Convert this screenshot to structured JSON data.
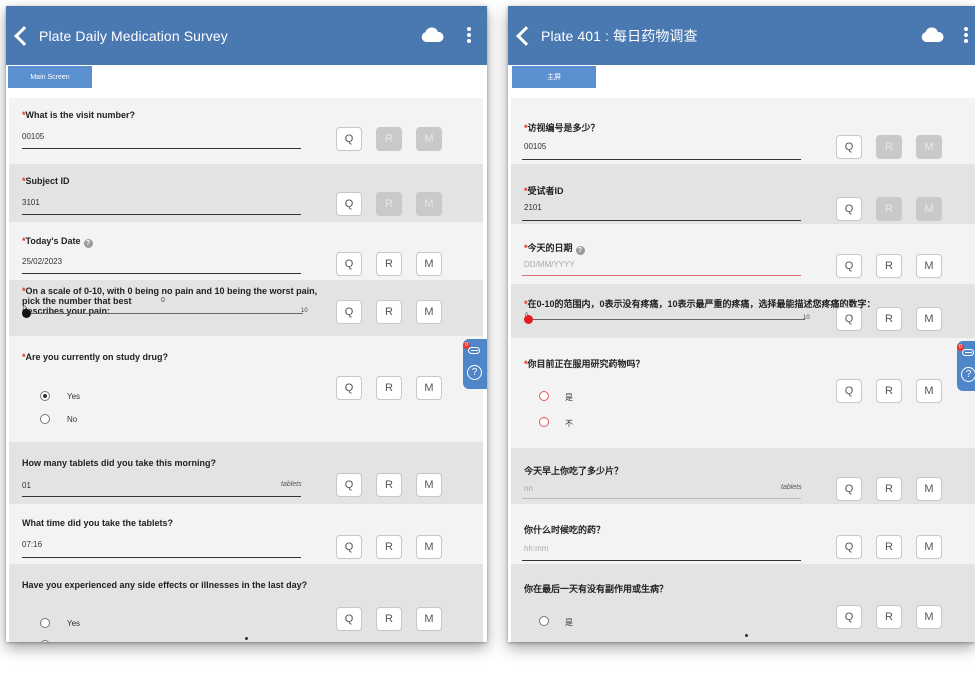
{
  "left": {
    "title": "Plate Daily Medication Survey",
    "tab": "Main Screen",
    "buttons": {
      "q": "Q",
      "r": "R",
      "m": "M"
    },
    "q1": {
      "label": "What is the visit number?",
      "value": "00105"
    },
    "q2": {
      "label": "Subject ID",
      "value": "3101"
    },
    "q3": {
      "label": "Today's Date",
      "value": "25/02/2023"
    },
    "q4": {
      "label_line1": "On a scale of 0-10, with 0 being no pain and 10 being the worst pain, pick the number that best",
      "label_line2": "describes your pain:",
      "current": "0",
      "min": "0",
      "max": "10",
      "level": 0
    },
    "q5": {
      "label": "Are you currently on study drug?",
      "options": [
        "Yes",
        "No"
      ],
      "selected": "Yes"
    },
    "q6": {
      "label": "How many tablets did you take this morning?",
      "value": "01",
      "unit": "tablets"
    },
    "q7": {
      "label": "What time did you take the tablets?",
      "value": "07:16"
    },
    "q8": {
      "label": "Have you experienced any side effects or illnesses in the last day?",
      "options": [
        "Yes"
      ]
    },
    "badge": "0",
    "help": "?"
  },
  "right": {
    "title": "Plate 401 : 每日药物调查",
    "tab": "主屏",
    "buttons": {
      "q": "Q",
      "r": "R",
      "m": "M"
    },
    "q1": {
      "label": "访视编号是多少？",
      "value": "00105"
    },
    "q2": {
      "label": "受试者ID",
      "value": "2101"
    },
    "q3": {
      "label": "今天的日期",
      "placeholder": "DD/MM/YYYY"
    },
    "q4": {
      "label": "在0-10的范围内，0表示没有疼痛，10表示最严重的疼痛，选择最能描述您疼痛的数字：",
      "min": "0",
      "max": "10",
      "level": 0
    },
    "q5": {
      "label": "你目前正在服用研究药物吗？",
      "options": [
        "是",
        "不"
      ]
    },
    "q6": {
      "label": "今天早上你吃了多少片？",
      "placeholder": "nn",
      "unit": "tablets"
    },
    "q7": {
      "label": "你什么时候吃的药？",
      "placeholder": "hh:mm"
    },
    "q8": {
      "label": "你在最后一天有没有副作用或生病？",
      "options": [
        "是"
      ]
    },
    "badge": "0",
    "help": "?"
  },
  "colors": {
    "appbar": "#4a78b0",
    "tab": "#5a8fd0",
    "required": "#d63030",
    "side_widget": "#4f86c9"
  },
  "icons": [
    "back-icon",
    "cloud-icon",
    "more-vert-icon",
    "info-icon",
    "clip-icon",
    "help-icon"
  ]
}
